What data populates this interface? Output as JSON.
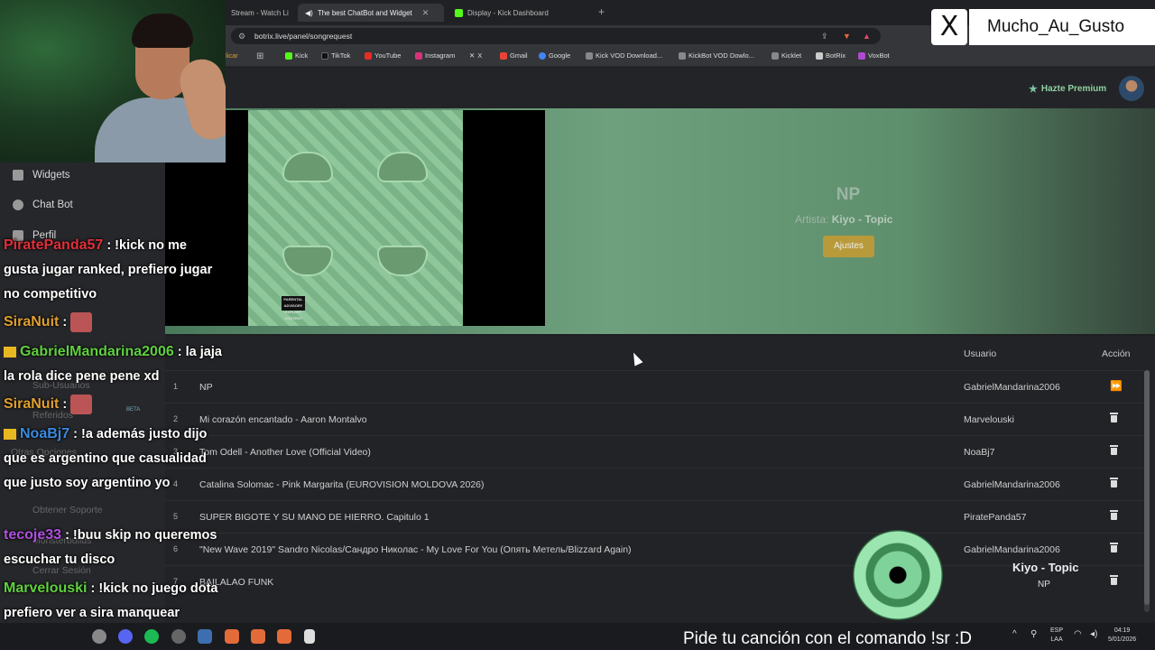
{
  "browser": {
    "tabs": [
      {
        "label": "Stream - Watch Li"
      },
      {
        "label": "The best ChatBot and Widget"
      },
      {
        "label": "Display - Kick Dashboard"
      }
    ],
    "new_tab": "+",
    "url": "botrix.live/panel/songrequest",
    "bookmarks": [
      "licar",
      "Kick",
      "TikTok",
      "YouTube",
      "Instagram",
      "X",
      "Gmail",
      "Google",
      "Kick VOD Download...",
      "KickBot VOD Dowlo...",
      "Kicklet",
      "BotRix",
      "VoxBot"
    ]
  },
  "header": {
    "premium_label": "Hazte Premium"
  },
  "now_playing": {
    "title": "NP",
    "artist_label": "Artista:",
    "artist": "Kiyo - Topic",
    "settings_button": "Ajustes",
    "cover_badge": "PARENTAL ADVISORY EXPLICIT CONTENT"
  },
  "queue": {
    "col_user": "Usuario",
    "col_action": "Acción",
    "rows": [
      {
        "num": "1",
        "song": "NP",
        "user": "GabrielMandarina2006",
        "action": "skip"
      },
      {
        "num": "2",
        "song": "Mi corazón encantado - Aaron Montalvo",
        "user": "Marvelouski",
        "action": "delete"
      },
      {
        "num": "3",
        "song": "Tom Odell - Another Love (Official Video)",
        "user": "NoaBj7",
        "action": "delete"
      },
      {
        "num": "4",
        "song": "Catalina Solomac - Pink Margarita (EUROVISION MOLDOVA 2026)",
        "user": "GabrielMandarina2006",
        "action": "delete"
      },
      {
        "num": "5",
        "song": "SUPER BIGOTE Y SU MANO DE HIERRO. Capitulo 1",
        "user": "PiratePanda57",
        "action": "delete"
      },
      {
        "num": "6",
        "song": "\"New Wave 2019\" Sandro Nicolas/Сандро Николас - My Love For You (Опять Метель/Blizzard Again)",
        "user": "GabrielMandarina2006",
        "action": "delete"
      },
      {
        "num": "7",
        "song": "BAILALAO FUNK",
        "user": "",
        "action": "delete"
      }
    ]
  },
  "sidebar": {
    "items": [
      {
        "label": "Widgets"
      },
      {
        "label": "Chat Bot"
      },
      {
        "label": "Perfil"
      }
    ],
    "faded": [
      "Sub-Usuarios",
      "Referidos",
      "Otras Opciones",
      "Obtener Soporte",
      "Monsterbuilds",
      "Cerrar Sesión"
    ],
    "beta": "BETA"
  },
  "chat": {
    "messages": [
      {
        "user": "PiratePanda57",
        "color": "#e0303a",
        "text": ": !kick no me gusta jugar ranked, prefiero jugar no competitivo"
      },
      {
        "user": "SiraNuit",
        "color": "#e0a030",
        "text": ":"
      },
      {
        "user": "GabrielMandarina2006",
        "color": "#60d040",
        "text": ": la jaja la rola dice pene pene xd"
      },
      {
        "user": "SiraNuit",
        "color": "#e0a030",
        "text": ":"
      },
      {
        "user": "NoaBj7",
        "color": "#3a8ae0",
        "text": ": !a además justo dijo que es argentino que casualidad que justo soy argentino yo"
      },
      {
        "user": "tecoje33",
        "color": "#b050e0",
        "text": ": !buu skip no queremos escuchar tu disco"
      },
      {
        "user": "Marvelouski",
        "color": "#60d040",
        "text": ": !kick no juego dota prefiero ver a sira manquear"
      }
    ]
  },
  "overlay": {
    "x_glyph": "X",
    "handle": "Mucho_Au_Gusto",
    "ticker": "Pide tu canción con el comando !sr :D"
  },
  "mini_player": {
    "artist": "Kiyo - Topic",
    "title": "NP"
  },
  "tray": {
    "lang": "ESP",
    "region": "LAA",
    "time": "04:19",
    "date": "5/01/2026"
  },
  "colors": {
    "premium": "#8fd19e",
    "ajustes": "#b89a3a",
    "hero": "#6fa07e"
  }
}
